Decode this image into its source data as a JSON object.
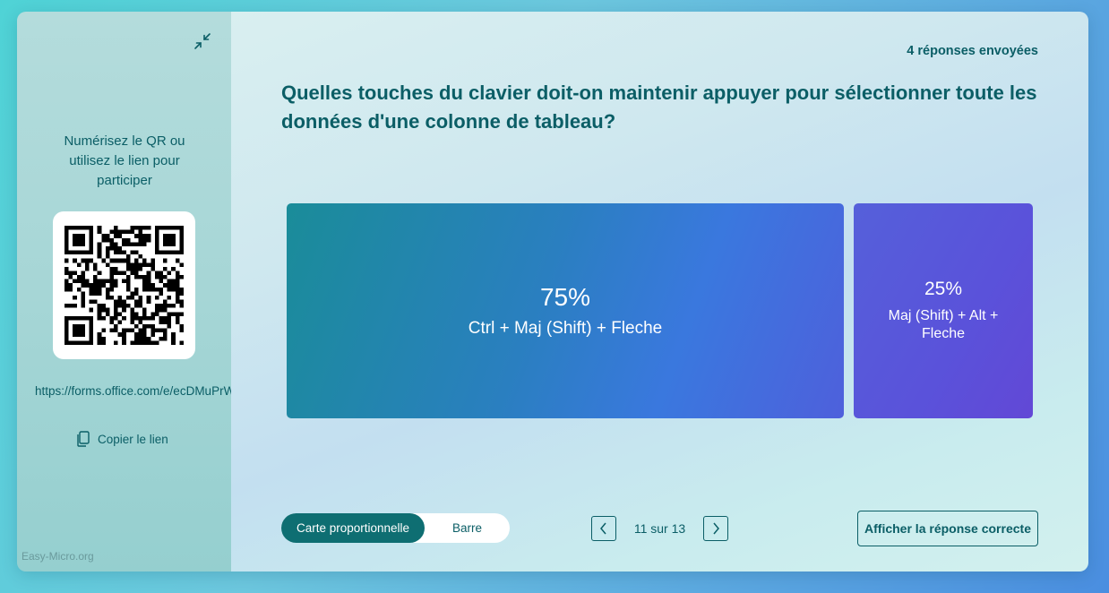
{
  "sidebar": {
    "collapse_icon": "collapse-arrows-icon",
    "scan_text": "Numérisez le QR ou utilisez le lien pour participer",
    "link_text": "https://forms.office.com/e/ecDMuPrWGB",
    "copy_label": "Copier le lien",
    "copy_icon": "copy-icon"
  },
  "watermark": "Easy-Micro.org",
  "main": {
    "responses": "4 réponses envoyées",
    "question": "Quelles touches du clavier doit-on maintenir appuyer pour sélectionner toute les données d'une colonne de tableau?",
    "results": [
      {
        "percent": "75%",
        "label": "Ctrl + Maj (Shift) + Fleche",
        "share": 0.75
      },
      {
        "percent": "25%",
        "label": "Maj (Shift) + Alt + Fleche",
        "share": 0.25
      }
    ],
    "view_toggle": {
      "active": "Carte proportionnelle",
      "inactive": "Barre"
    },
    "pager": {
      "text": "11 sur 13",
      "prev_icon": "chevron-left-icon",
      "next_icon": "chevron-right-icon"
    },
    "answer_button": "Afficher la réponse correcte"
  },
  "colors": {
    "accent": "#0e6e72",
    "text": "#0b5e66",
    "tile_a_start": "#1a8c99",
    "tile_a_end": "#4e60dc",
    "tile_b": "#5a52da"
  }
}
